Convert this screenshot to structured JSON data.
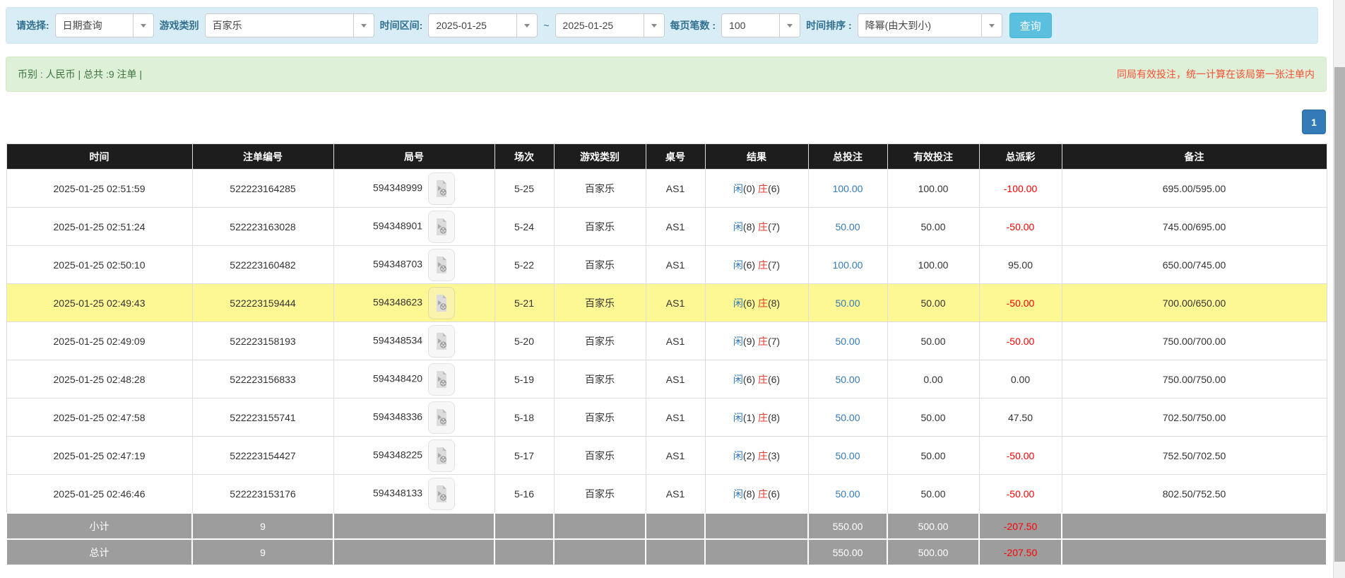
{
  "filter_bar": {
    "fields": [
      {
        "id": "query-type",
        "label": "请选择:",
        "value": "日期查询"
      },
      {
        "id": "game-category",
        "label": "游戏类别",
        "value": "百家乐"
      },
      {
        "id": "date-from",
        "label": "时间区间:",
        "value": "2025-01-25"
      },
      {
        "id": "date-to",
        "prefix": "~",
        "value": "2025-01-25"
      },
      {
        "id": "page-size",
        "label": "每页笔数 :",
        "value": "100"
      },
      {
        "id": "time-sort",
        "label": "时间排序 :",
        "value": "降幂(由大到小)"
      }
    ],
    "search_button": "查询"
  },
  "summary_bar": {
    "left": "币别 : 人民币 | 总共 :9 注单 |",
    "right": "同局有效投注，统一计算在该局第一张注单内"
  },
  "pagination": {
    "pages": [
      "1"
    ]
  },
  "table": {
    "headers": [
      "时间",
      "注单编号",
      "局号",
      "场次",
      "游戏类别",
      "桌号",
      "结果",
      "总投注",
      "有效投注",
      "总派彩",
      "备注"
    ],
    "result_labels": {
      "player": "闲",
      "banker": "庄"
    },
    "rows": [
      {
        "time": "2025-01-25 02:51:59",
        "bet_id": "522223164285",
        "round_id": "594348999",
        "session": "5-25",
        "game": "百家乐",
        "table_no": "AS1",
        "player_num": "(0)",
        "banker_num": "(6)",
        "total_bet": "100.00",
        "valid_bet": "100.00",
        "payout": "-100.00",
        "remark": "695.00/595.00",
        "highlight": false
      },
      {
        "time": "2025-01-25 02:51:24",
        "bet_id": "522223163028",
        "round_id": "594348901",
        "session": "5-24",
        "game": "百家乐",
        "table_no": "AS1",
        "player_num": "(8)",
        "banker_num": "(7)",
        "total_bet": "50.00",
        "valid_bet": "50.00",
        "payout": "-50.00",
        "remark": "745.00/695.00",
        "highlight": false
      },
      {
        "time": "2025-01-25 02:50:10",
        "bet_id": "522223160482",
        "round_id": "594348703",
        "session": "5-22",
        "game": "百家乐",
        "table_no": "AS1",
        "player_num": "(6)",
        "banker_num": "(7)",
        "total_bet": "100.00",
        "valid_bet": "100.00",
        "payout": "95.00",
        "remark": "650.00/745.00",
        "highlight": false
      },
      {
        "time": "2025-01-25 02:49:43",
        "bet_id": "522223159444",
        "round_id": "594348623",
        "session": "5-21",
        "game": "百家乐",
        "table_no": "AS1",
        "player_num": "(6)",
        "banker_num": "(8)",
        "total_bet": "50.00",
        "valid_bet": "50.00",
        "payout": "-50.00",
        "remark": "700.00/650.00",
        "highlight": true
      },
      {
        "time": "2025-01-25 02:49:09",
        "bet_id": "522223158193",
        "round_id": "594348534",
        "session": "5-20",
        "game": "百家乐",
        "table_no": "AS1",
        "player_num": "(9)",
        "banker_num": "(7)",
        "total_bet": "50.00",
        "valid_bet": "50.00",
        "payout": "-50.00",
        "remark": "750.00/700.00",
        "highlight": false
      },
      {
        "time": "2025-01-25 02:48:28",
        "bet_id": "522223156833",
        "round_id": "594348420",
        "session": "5-19",
        "game": "百家乐",
        "table_no": "AS1",
        "player_num": "(6)",
        "banker_num": "(6)",
        "total_bet": "50.00",
        "valid_bet": "0.00",
        "payout": "0.00",
        "remark": "750.00/750.00",
        "highlight": false
      },
      {
        "time": "2025-01-25 02:47:58",
        "bet_id": "522223155741",
        "round_id": "594348336",
        "session": "5-18",
        "game": "百家乐",
        "table_no": "AS1",
        "player_num": "(1)",
        "banker_num": "(8)",
        "total_bet": "50.00",
        "valid_bet": "50.00",
        "payout": "47.50",
        "remark": "702.50/750.00",
        "highlight": false
      },
      {
        "time": "2025-01-25 02:47:19",
        "bet_id": "522223154427",
        "round_id": "594348225",
        "session": "5-17",
        "game": "百家乐",
        "table_no": "AS1",
        "player_num": "(2)",
        "banker_num": "(3)",
        "total_bet": "50.00",
        "valid_bet": "50.00",
        "payout": "-50.00",
        "remark": "752.50/702.50",
        "highlight": false
      },
      {
        "time": "2025-01-25 02:46:46",
        "bet_id": "522223153176",
        "round_id": "594348133",
        "session": "5-16",
        "game": "百家乐",
        "table_no": "AS1",
        "player_num": "(8)",
        "banker_num": "(6)",
        "total_bet": "50.00",
        "valid_bet": "50.00",
        "payout": "-50.00",
        "remark": "802.50/752.50",
        "highlight": false
      }
    ],
    "footer": [
      {
        "label": "小计",
        "count": "9",
        "total_bet": "550.00",
        "valid_bet": "500.00",
        "payout": "-207.50"
      },
      {
        "label": "总计",
        "count": "9",
        "total_bet": "550.00",
        "valid_bet": "500.00",
        "payout": "-207.50"
      }
    ]
  },
  "icons": {
    "combo_arrow": "chevron-down-icon",
    "round_video": "video-replay-icon"
  },
  "colors": {
    "accent_blue": "#337ab7",
    "search_button_blue": "#5bc0de",
    "filter_bar_bg": "#d9edf7",
    "summary_bar_bg": "#dff0d8",
    "summary_text_green": "#3c763d",
    "notice_red": "#f85032",
    "negative_red": "#ff0000",
    "banker_red": "#e4392e",
    "highlight_yellow": "#fdf794",
    "header_black": "#1d1d1d",
    "footer_gray": "#9d9d9d"
  }
}
